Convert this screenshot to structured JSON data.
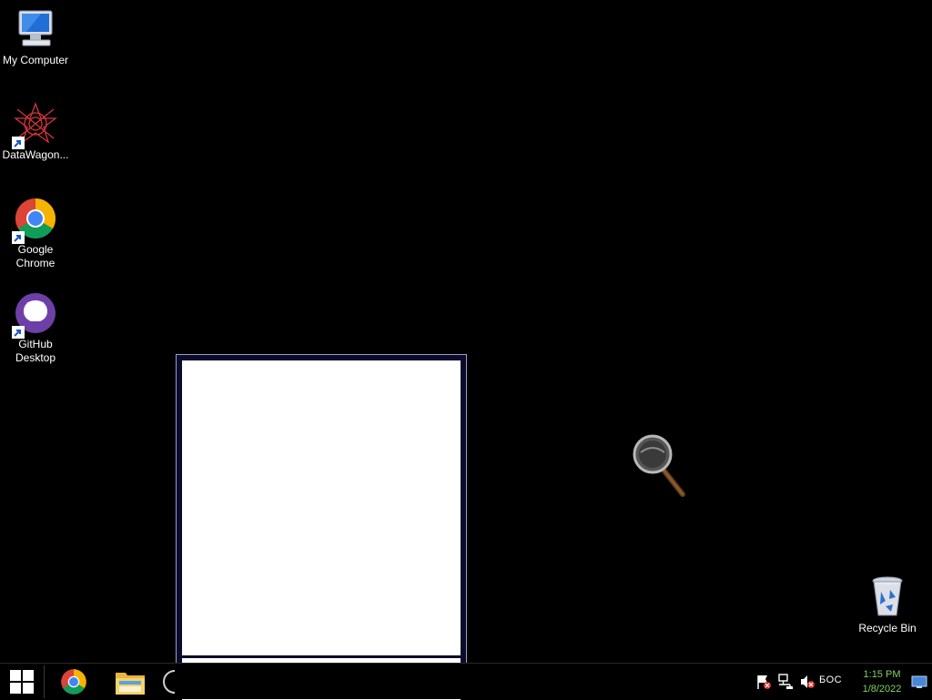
{
  "desktop": {
    "icons": [
      {
        "label": "My Computer",
        "icon": "computer-icon"
      },
      {
        "label": "DataWagon...",
        "icon": "datawagon-icon"
      },
      {
        "label": "Google Chrome",
        "icon": "chrome-icon"
      },
      {
        "label": "GitHub Desktop",
        "icon": "github-desktop-icon"
      },
      {
        "label": "Recycle Bin",
        "icon": "recycle-bin-icon"
      }
    ]
  },
  "taskbar": {
    "pinned": [
      "start-icon",
      "chrome-icon",
      "file-explorer-icon"
    ],
    "tray": {
      "language": "БОС",
      "time": "1:15 PM",
      "date": "1/8/2022",
      "icons": [
        "action-center-flag-icon",
        "network-icon",
        "volume-muted-icon"
      ]
    }
  },
  "colors": {
    "desktop_bg": "#000000",
    "clock_text": "#7fd35e",
    "popup_frame": "#0a0a2a"
  }
}
